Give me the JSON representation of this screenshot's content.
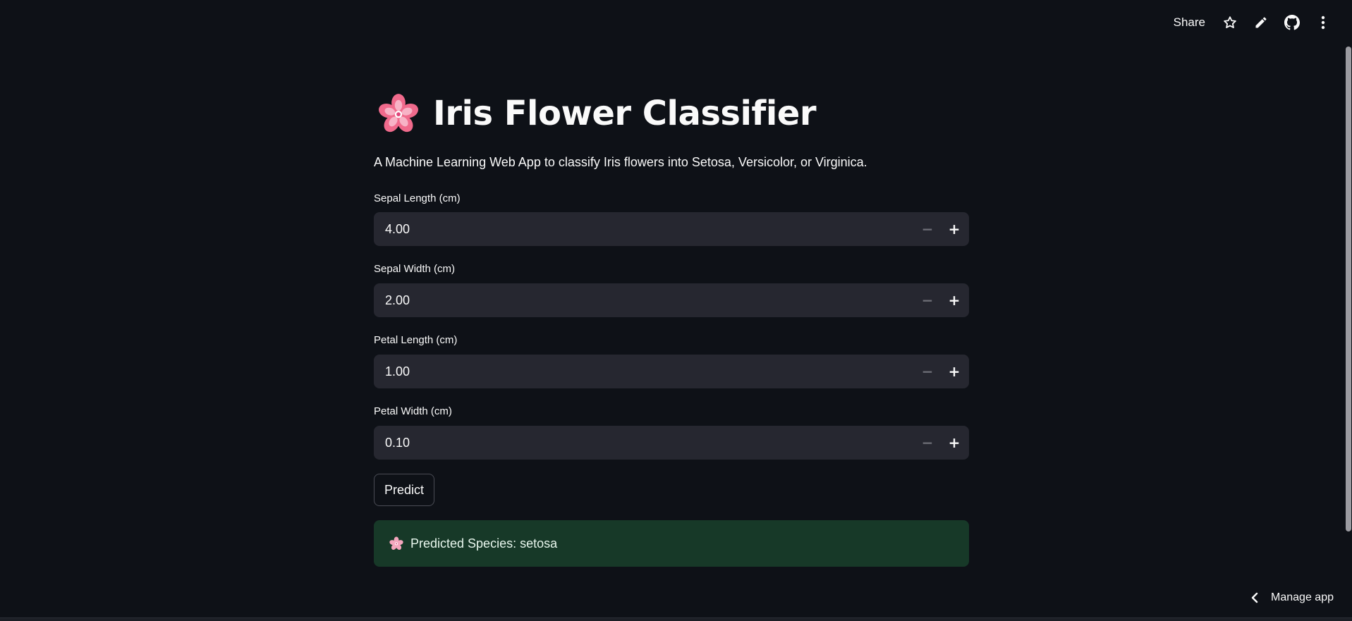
{
  "toolbar": {
    "share_label": "Share",
    "icons": [
      "star-icon",
      "pencil-icon",
      "github-icon",
      "kebab-menu-icon"
    ]
  },
  "app": {
    "title": "Iris Flower Classifier",
    "title_icon": "cherry-blossom-icon",
    "subtitle": "A Machine Learning Web App to classify Iris flowers into Setosa, Versicolor, or Virginica."
  },
  "inputs": [
    {
      "label": "Sepal Length (cm)",
      "value": "4.00"
    },
    {
      "label": "Sepal Width (cm)",
      "value": "2.00"
    },
    {
      "label": "Petal Length (cm)",
      "value": "1.00"
    },
    {
      "label": "Petal Width (cm)",
      "value": "0.10"
    }
  ],
  "predict_label": "Predict",
  "result": {
    "icon": "cherry-blossom-icon",
    "text": "Predicted Species: setosa"
  },
  "footer": {
    "manage_label": "Manage app",
    "manage_icon": "chevron-left-icon"
  },
  "colors": {
    "background": "#0e1117",
    "input_bg": "#262730",
    "success_bg": "#173928",
    "text": "#fafafa"
  }
}
